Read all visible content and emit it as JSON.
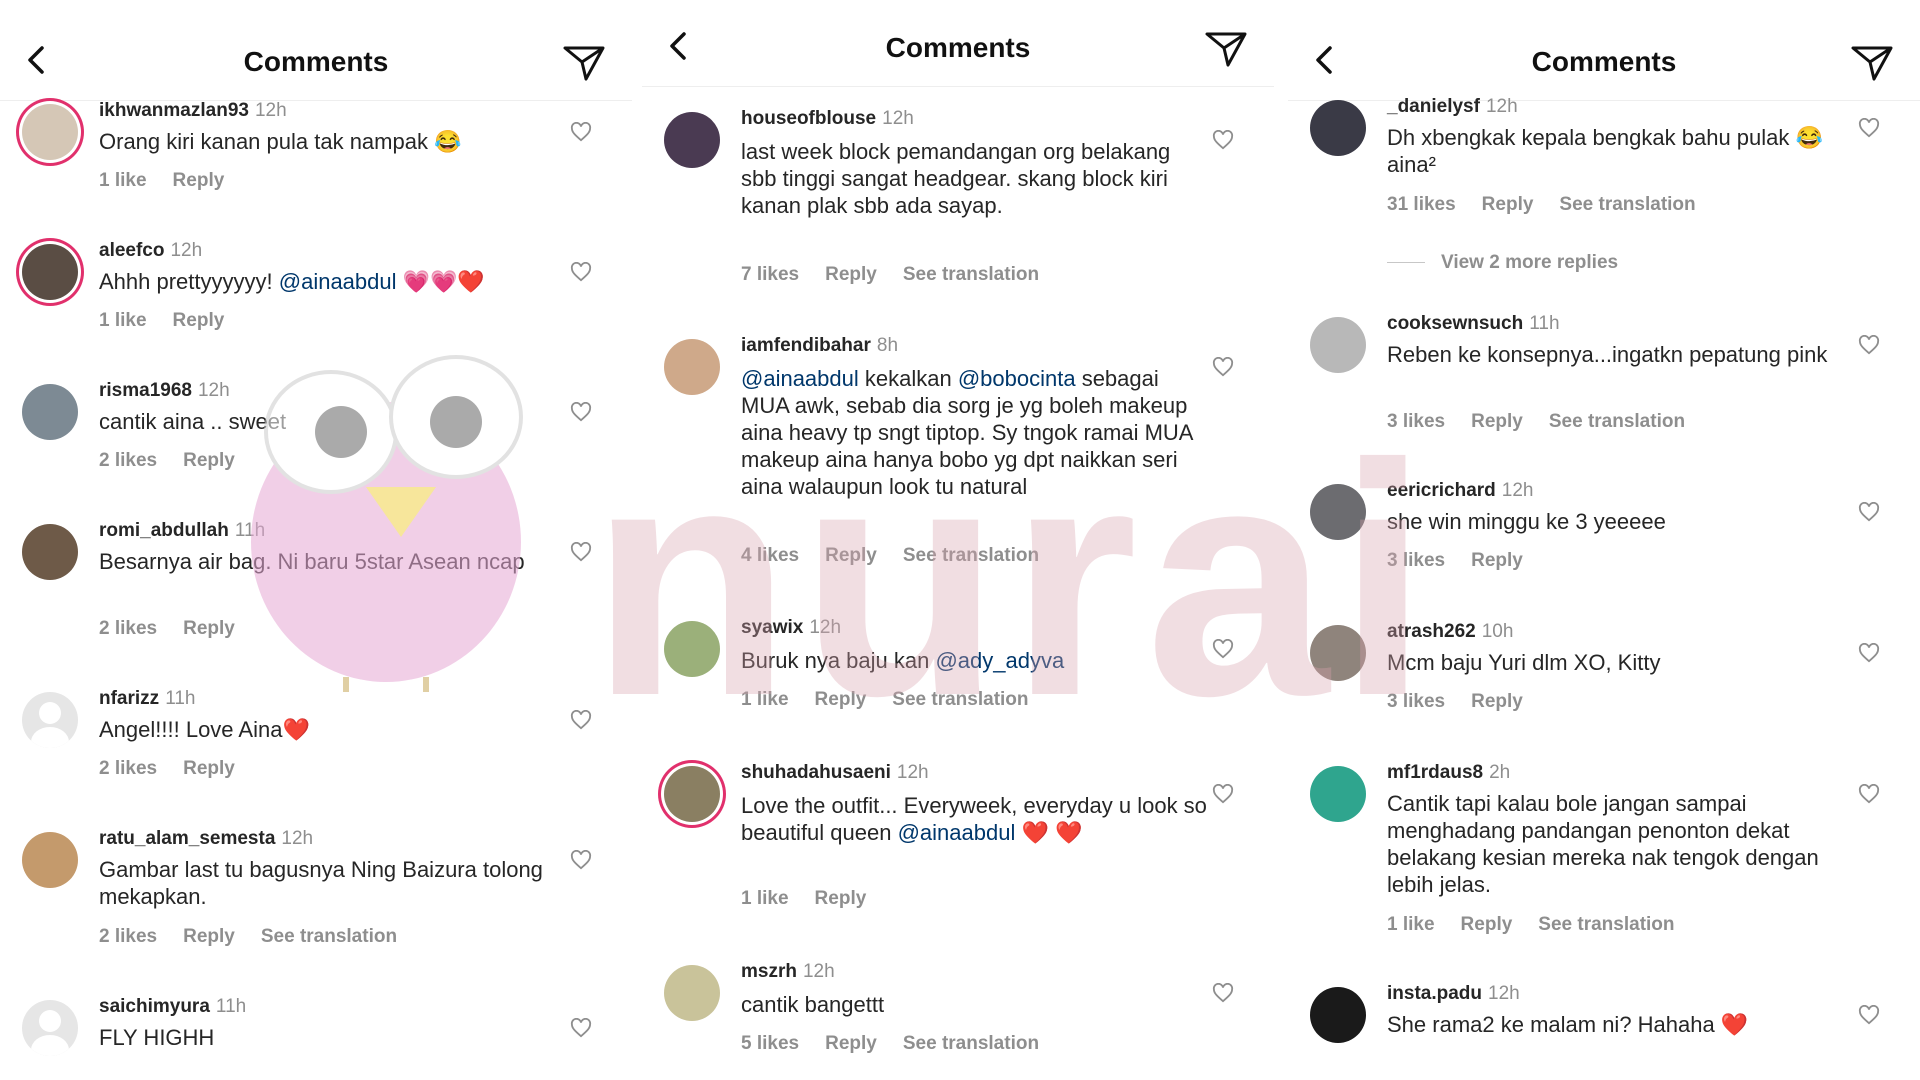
{
  "panels": [
    {
      "title": "Comments",
      "comments": [
        {
          "username": "ikhwanmazlan93",
          "time": "12h",
          "text": "Orang kiri kanan pula tak nampak 😂",
          "actions": [
            "1 like",
            "Reply"
          ]
        },
        {
          "username": "aleefco",
          "time": "12h",
          "text_before": "Ahhh prettyyyyyy! ",
          "mention": "@ainaabdul",
          "text_after": " 💗💗❤️",
          "actions": [
            "1 like",
            "Reply"
          ]
        },
        {
          "username": "risma1968",
          "time": "12h",
          "text": "cantik aina .. sweet",
          "actions": [
            "2 likes",
            "Reply"
          ]
        },
        {
          "username": "romi_abdullah",
          "time": "11h",
          "text": "Besarnya air bag. Ni baru 5star Asean ncap",
          "actions": [
            "2 likes",
            "Reply"
          ]
        },
        {
          "username": "nfarizz",
          "time": "11h",
          "text": "Angel!!!! Love Aina❤️",
          "actions": [
            "2 likes",
            "Reply"
          ]
        },
        {
          "username": "ratu_alam_semesta",
          "time": "12h",
          "text": "Gambar last tu bagusnya Ning Baizura tolong mekapkan.",
          "actions": [
            "2 likes",
            "Reply",
            "See translation"
          ]
        },
        {
          "username": "saichimyura",
          "time": "11h",
          "text": "FLY HIGHH",
          "actions": []
        }
      ]
    },
    {
      "title": "Comments",
      "comments": [
        {
          "username": "houseofblouse",
          "time": "12h",
          "text": "last week block pemandangan org belakang sbb tinggi sangat headgear. skang block kiri kanan plak sbb ada sayap.",
          "actions": [
            "7 likes",
            "Reply",
            "See translation"
          ]
        },
        {
          "username": "iamfendibahar",
          "time": "8h",
          "mention1": "@ainaabdul",
          "text_mid": " kekalkan ",
          "mention2": "@bobocinta",
          "text_after": " sebagai MUA awk, sebab dia sorg je yg boleh makeup aina heavy tp sngt tiptop. Sy tngok ramai MUA makeup aina hanya bobo yg dpt naikkan seri aina walaupun look tu natural",
          "actions": [
            "4 likes",
            "Reply",
            "See translation"
          ]
        },
        {
          "username": "syawix",
          "time": "12h",
          "text_before": "Buruk nya baju kan ",
          "mention": "@ady_adyva",
          "text_after": "",
          "actions": [
            "1 like",
            "Reply",
            "See translation"
          ]
        },
        {
          "username": "shuhadahusaeni",
          "time": "12h",
          "text_before": "Love the outfit... Everyweek, everyday u look so beautiful queen ",
          "mention": "@ainaabdul",
          "text_after": " ❤️ ❤️",
          "actions": [
            "1 like",
            "Reply"
          ]
        },
        {
          "username": "mszrh",
          "time": "12h",
          "text": "cantik bangettt",
          "actions": [
            "5 likes",
            "Reply",
            "See translation"
          ]
        }
      ]
    },
    {
      "title": "Comments",
      "comments": [
        {
          "username": "_danielysf",
          "time": "12h",
          "text": "Dh xbengkak kepala bengkak bahu pulak 😂 aina²",
          "actions": [
            "31 likes",
            "Reply",
            "See translation"
          ]
        },
        {
          "username": "cooksewnsuch",
          "time": "11h",
          "text": "Reben ke konsepnya...ingatkn pepatung pink",
          "actions": [
            "3 likes",
            "Reply",
            "See translation"
          ]
        },
        {
          "username": "eericrichard",
          "time": "12h",
          "text": "she win minggu ke 3 yeeeee",
          "actions": [
            "3 likes",
            "Reply"
          ]
        },
        {
          "username": "atrash262",
          "time": "10h",
          "text": "Mcm baju Yuri dlm XO, Kitty",
          "actions": [
            "3 likes",
            "Reply"
          ]
        },
        {
          "username": "mf1rdaus8",
          "time": "2h",
          "text": "Cantik tapi kalau bole jangan sampai menghadang pandangan penonton dekat belakang kesian mereka nak tengok dengan lebih jelas.",
          "actions": [
            "1 like",
            "Reply",
            "See translation"
          ]
        },
        {
          "username": "insta.padu",
          "time": "12h",
          "text": "She rama2 ke malam ni? Hahaha ❤️",
          "actions": []
        }
      ],
      "view_more": "View 2 more replies"
    }
  ],
  "watermark": "nurai",
  "colors": {
    "mention": "#00376b",
    "secondary": "#8e8e8e",
    "text": "#262626",
    "ring": "#e1306c"
  },
  "icons": {
    "back": "chevron-left-icon",
    "send": "paper-plane-icon",
    "like": "heart-outline-icon"
  }
}
